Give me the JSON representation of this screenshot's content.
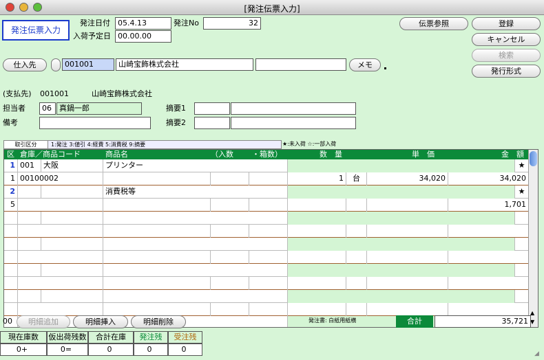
{
  "window": {
    "title": "[発注伝票入力]"
  },
  "header": {
    "mode_button": "発注伝票入力",
    "order_date_label": "発注日付",
    "order_date": "05.4.13",
    "order_no_label": "発注No",
    "order_no": "32",
    "arrival_label": "入荷予定日",
    "arrival_date": "00.00.00"
  },
  "toolbar": {
    "ref_button": "伝票参照",
    "register_button": "登録",
    "cancel_button": "キャンセル",
    "search_button": "検索",
    "format_button": "発行形式"
  },
  "supplier": {
    "button": "仕入先",
    "code": "001001",
    "name": "山崎宝飾株式会社",
    "memo_button": "メモ",
    "payee_label": "(支払先)",
    "payee_code": "001001",
    "payee_name": "山崎宝飾株式会社"
  },
  "fields": {
    "staff_label": "担当者",
    "staff_code": "06",
    "staff_name": "真鍋一郎",
    "note_label": "備考",
    "summary1_label": "摘要1",
    "summary2_label": "摘要2"
  },
  "legend": {
    "category_label": "取引区分",
    "category_text": "1:発注 3:値引 4:経費 5:消費税 9:摘要",
    "arrival_text": "★:未入荷 ☆:一部入荷"
  },
  "grid": {
    "headers": {
      "kubun": "区",
      "warehouse": "倉庫／商品コード",
      "product": "商品名",
      "irisu": "（入数",
      "hakosu": "・箱数）",
      "qty": "数　量",
      "price": "単　価",
      "amount": "金　額"
    },
    "rows": [
      {
        "a": "1",
        "b": "001",
        "c": "大阪",
        "d": "プリンター",
        "star": "★"
      },
      {
        "a": "1",
        "b": "00100002",
        "qty": "1",
        "unit": "台",
        "price": "34,020",
        "amount": "34,020"
      },
      {
        "a": "2",
        "d": "消費税等",
        "star": "★"
      },
      {
        "a": "5",
        "amount": "1,701"
      }
    ]
  },
  "footer": {
    "count": "00",
    "add_button": "明細追加",
    "insert_button": "明細挿入",
    "delete_button": "明細削除",
    "form_text": "発注書: 白紙用紙横",
    "total_label": "合計",
    "total": "35,721"
  },
  "stock": {
    "h1": "現在庫数",
    "h2": "仮出荷残数",
    "h3": "合計在庫",
    "h4": "発注残",
    "h5": "受注残",
    "v1": "0+",
    "v2": "0=",
    "v3": "0",
    "v4": "0",
    "v5": "0"
  }
}
